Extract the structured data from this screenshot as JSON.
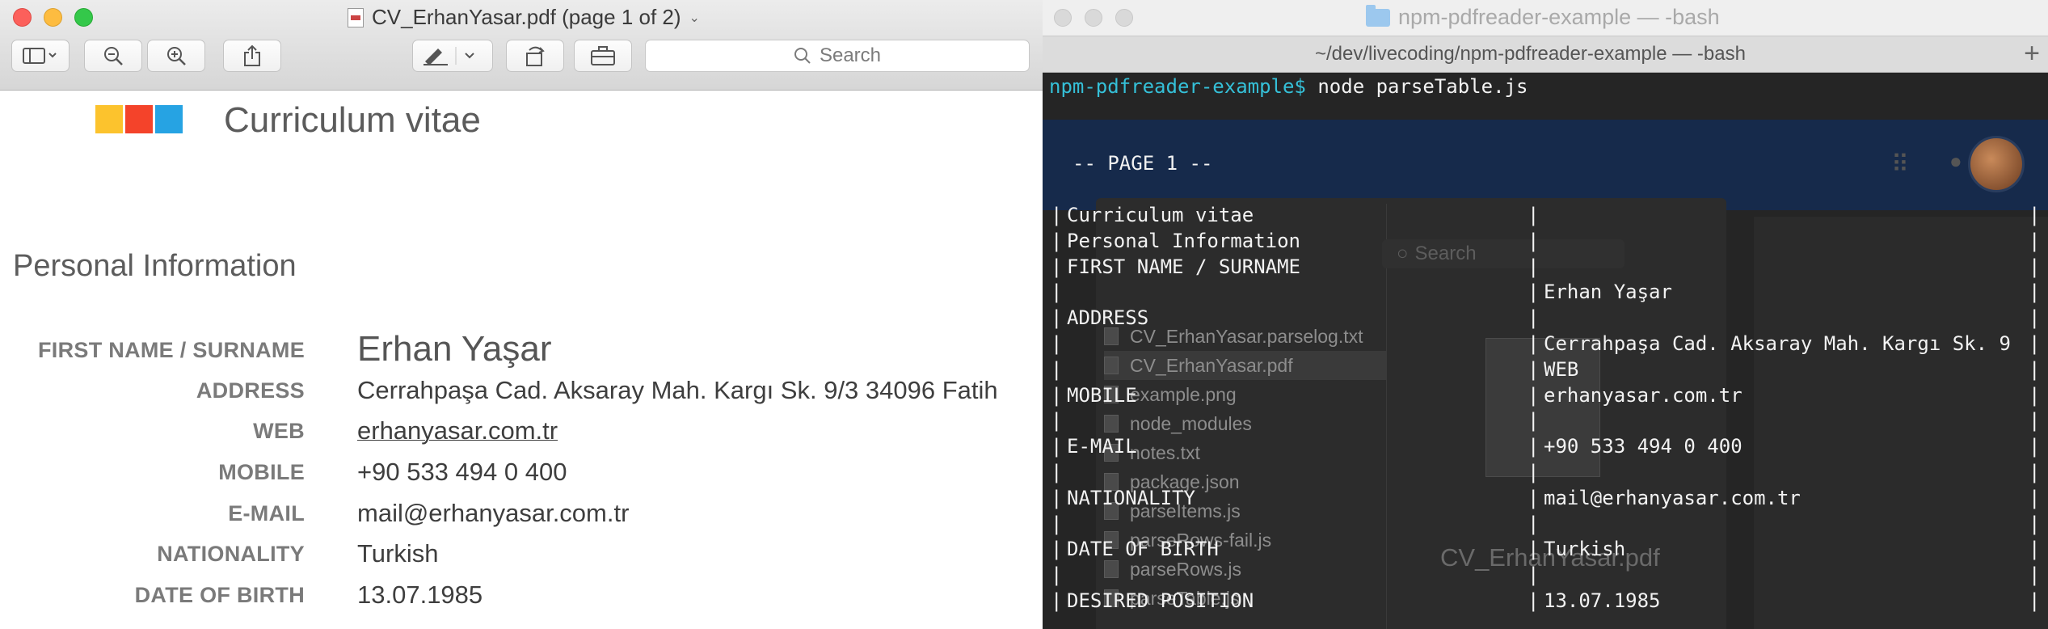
{
  "preview": {
    "window_title": "CV_ErhanYasar.pdf (page 1 of 2)",
    "search_placeholder": "Search",
    "logo_colors": [
      "#fcc32d",
      "#f4432a",
      "#26a3e3"
    ],
    "cv_title": "Curriculum vitae",
    "section_title": "Personal Information",
    "fields": [
      {
        "label": "FIRST NAME / SURNAME",
        "value": "Erhan Yaşar"
      },
      {
        "label": "ADDRESS",
        "value": "Cerrahpaşa Cad. Aksaray Mah. Kargı Sk. 9/3 34096 Fatih"
      },
      {
        "label": "WEB",
        "value": "erhanyasar.com.tr"
      },
      {
        "label": "MOBILE",
        "value": "+90 533 494 0 400"
      },
      {
        "label": "E-MAIL",
        "value": "mail@erhanyasar.com.tr"
      },
      {
        "label": "NATIONALITY",
        "value": "Turkish"
      },
      {
        "label": "DATE OF BIRTH",
        "value": "13.07.1985"
      }
    ]
  },
  "terminal": {
    "window_title": "npm-pdfreader-example — -bash",
    "tab_title": "~/dev/livecoding/npm-pdfreader-example — -bash",
    "prompt": "npm-pdfreader-example$",
    "command": " node parseTable.js",
    "page_marker": "-- PAGE 1 --",
    "left_col": [
      "Curriculum vitae",
      "Personal Information",
      "FIRST NAME / SURNAME",
      "",
      "ADDRESS",
      "",
      "",
      "MOBILE",
      "",
      "E-MAIL",
      "",
      "NATIONALITY",
      "",
      "DATE OF BIRTH",
      "",
      "DESIRED POSITION"
    ],
    "right_col": [
      "",
      "",
      "",
      "Erhan Yaşar",
      "",
      "Cerrahpaşa Cad. Aksaray Mah. Kargı Sk. 9",
      "WEB",
      "erhanyasar.com.tr",
      "",
      "+90 533 494 0 400",
      "",
      "mail@erhanyasar.com.tr",
      "",
      "Turkish",
      "",
      "13.07.1985"
    ]
  },
  "background": {
    "search": "Search",
    "files": [
      "CV_ErhanYasar.parselog.txt",
      "CV_ErhanYasar.pdf",
      "example.png",
      "node_modules",
      "notes.txt",
      "package.json",
      "parseItems.js",
      "parseRows-fail.js",
      "parseRows.js",
      "parseTable.js"
    ],
    "preview_filename": "CV_ErhanYasar.pdf"
  }
}
